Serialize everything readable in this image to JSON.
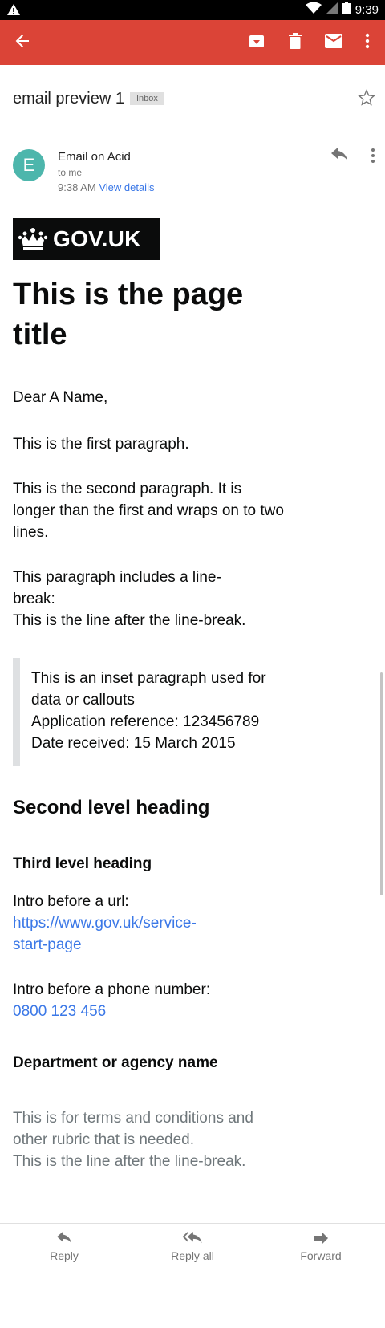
{
  "status_bar": {
    "time": "9:39"
  },
  "toolbar": {
    "back_icon": "arrow-back-icon",
    "archive_icon": "archive-icon",
    "delete_icon": "trash-icon",
    "mark_unread_icon": "mail-icon",
    "more_icon": "more-vert-icon",
    "color": "#db4437"
  },
  "message": {
    "subject": "email preview 1",
    "label": "Inbox",
    "sender_initial": "E",
    "sender_name": "Email on Acid",
    "recipient": "to me",
    "time": "9:38 AM",
    "view_details": "View details"
  },
  "body": {
    "logo_text": "GOV.UK",
    "title": "This is the page title",
    "greeting": "Dear A Name,",
    "para1": "This is the first paragraph.",
    "para2": "This is the second paragraph. It is longer than the first and wraps on to two lines.",
    "para3_line1": "This paragraph includes a line-break:",
    "para3_line2": "This is the line after the line-break.",
    "inset_line1": "This is an inset paragraph used for data or callouts",
    "inset_line2": "Application reference: 123456789",
    "inset_line3": "Date received: 15 March 2015",
    "heading2": "Second level heading",
    "heading3": "Third level heading",
    "url_intro": "Intro before a url:",
    "url": "https://www.gov.uk/service-start-page",
    "phone_intro": "Intro before a phone number:",
    "phone": "0800 123 456",
    "department": "Department or agency name",
    "terms_line1": "This is for terms and conditions and other rubric that is needed.",
    "terms_line2": "This is the line after the line-break."
  },
  "actions": {
    "reply": "Reply",
    "reply_all": "Reply all",
    "forward": "Forward"
  }
}
